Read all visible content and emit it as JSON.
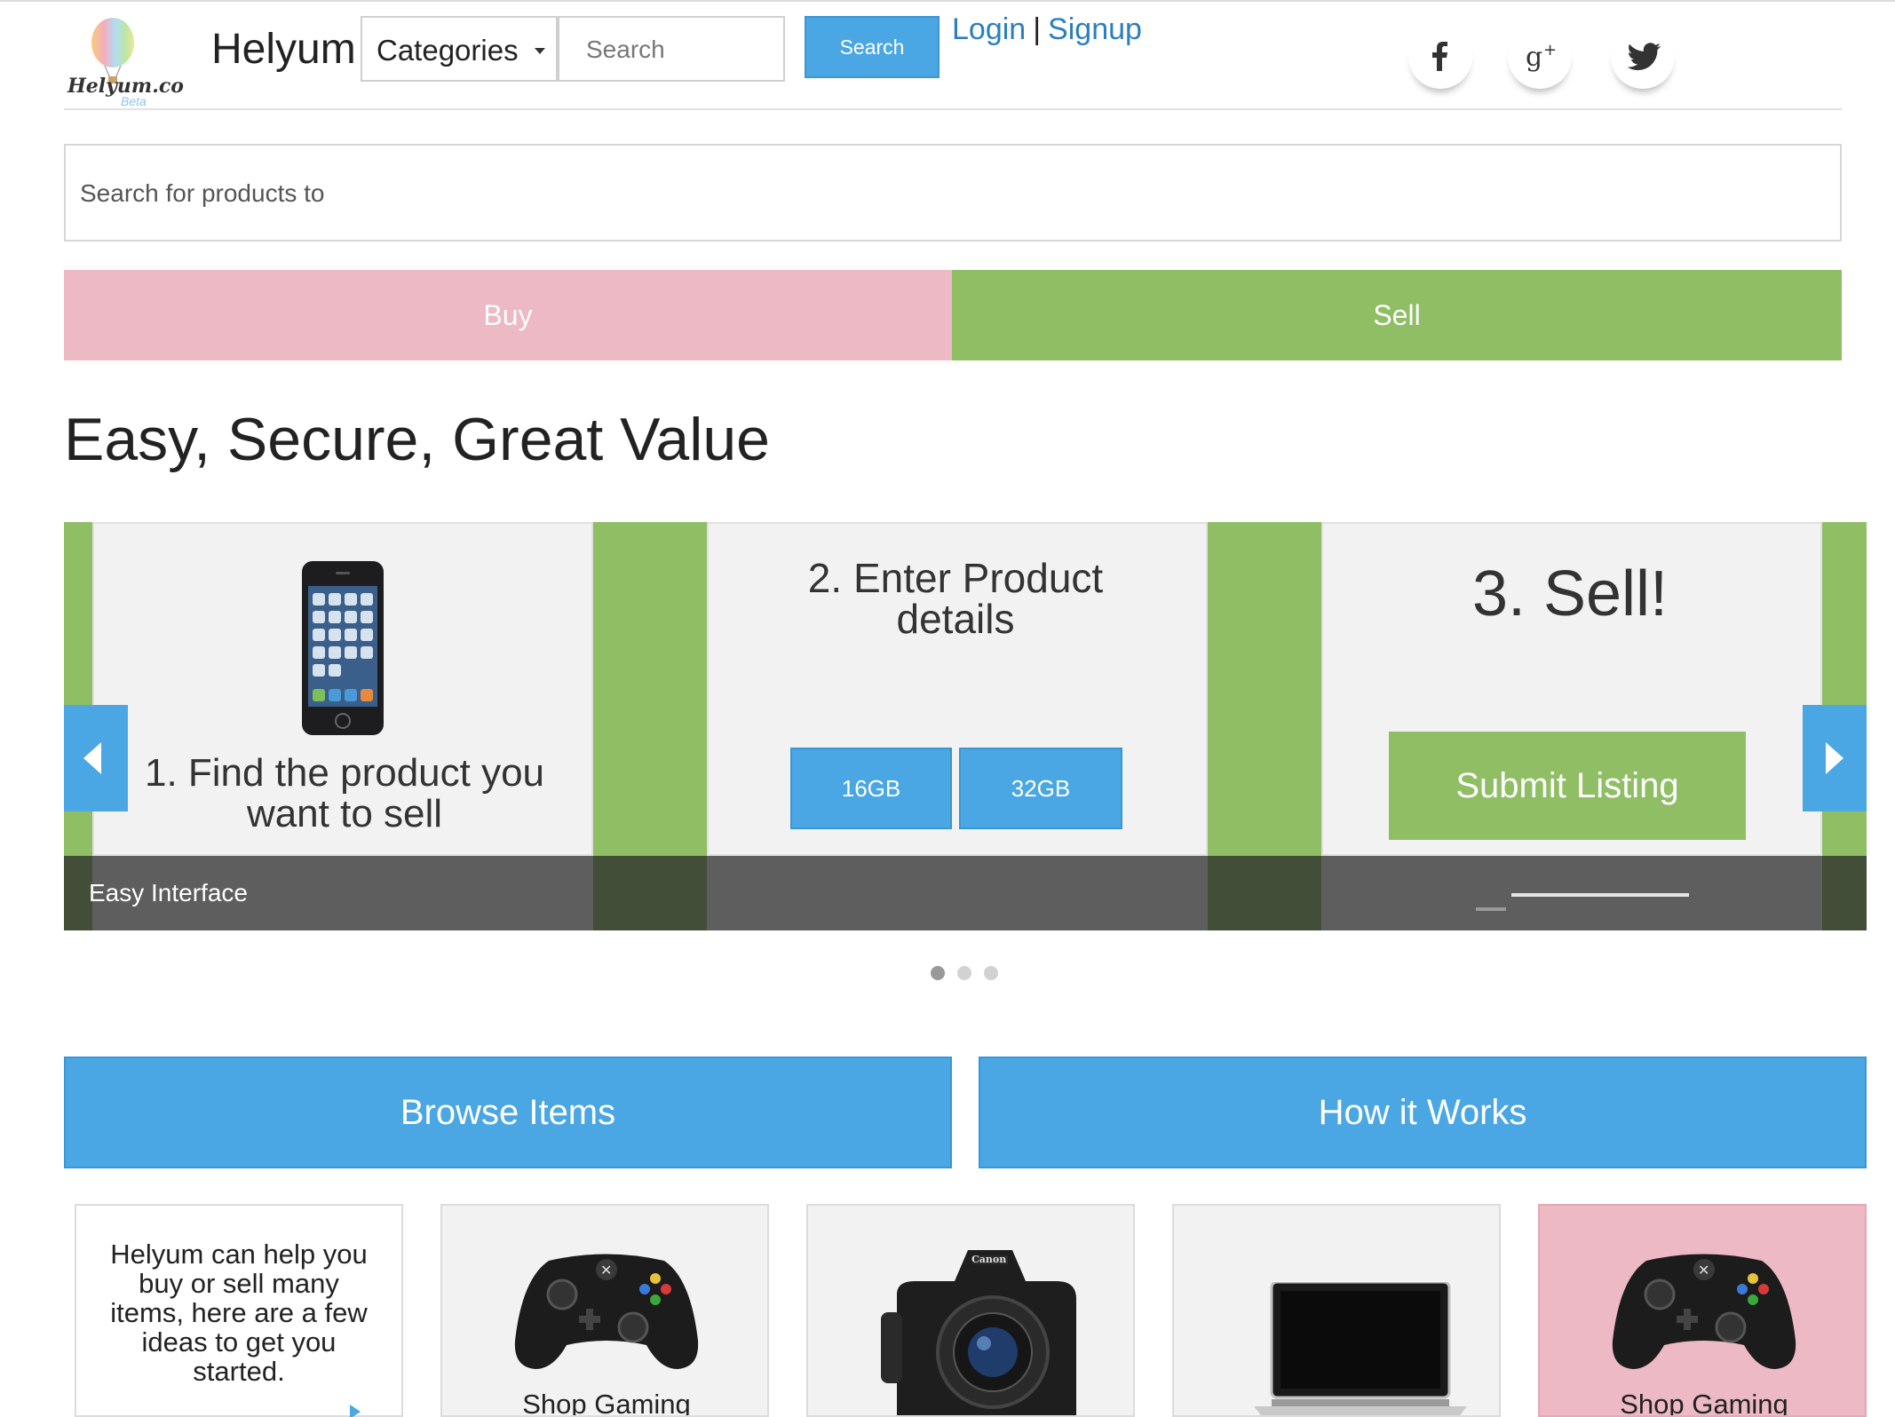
{
  "header": {
    "logo_text": "Helyum.co",
    "logo_badge": "Beta",
    "brand": "Helyum",
    "categories_label": "Categories",
    "search_placeholder": "Search",
    "search_button": "Search",
    "login": "Login",
    "separator": "|",
    "signup": "Signup",
    "social": [
      "facebook-icon",
      "google-plus-icon",
      "twitter-icon"
    ]
  },
  "main_search": {
    "placeholder": "Search for products to"
  },
  "tabs": {
    "buy": "Buy",
    "sell": "Sell"
  },
  "headline": "Easy, Secure, Great Value",
  "carousel": {
    "step1": "1. Find the product you want to sell",
    "step2": "2. Enter Product details",
    "options": [
      "16GB",
      "32GB"
    ],
    "step3": "3. Sell!",
    "submit": "Submit Listing",
    "caption": "Easy Interface",
    "dots": 3,
    "active_dot": 0
  },
  "sections": {
    "browse": "Browse Items",
    "how": "How it Works"
  },
  "cards": {
    "intro": "Helyum can help you buy or sell many items, here are a few ideas to get you started.",
    "items": [
      {
        "label": "Shop Gaming",
        "icon": "game-controller-icon"
      },
      {
        "label": "",
        "icon": "camera-icon"
      },
      {
        "label": "",
        "icon": "laptop-icon"
      },
      {
        "label": "Shop Gaming",
        "icon": "game-controller-icon"
      }
    ]
  },
  "colors": {
    "blue": "#4aa7e3",
    "green": "#8fbe64",
    "pink": "#ecb9c4",
    "link": "#2a7fc0"
  }
}
